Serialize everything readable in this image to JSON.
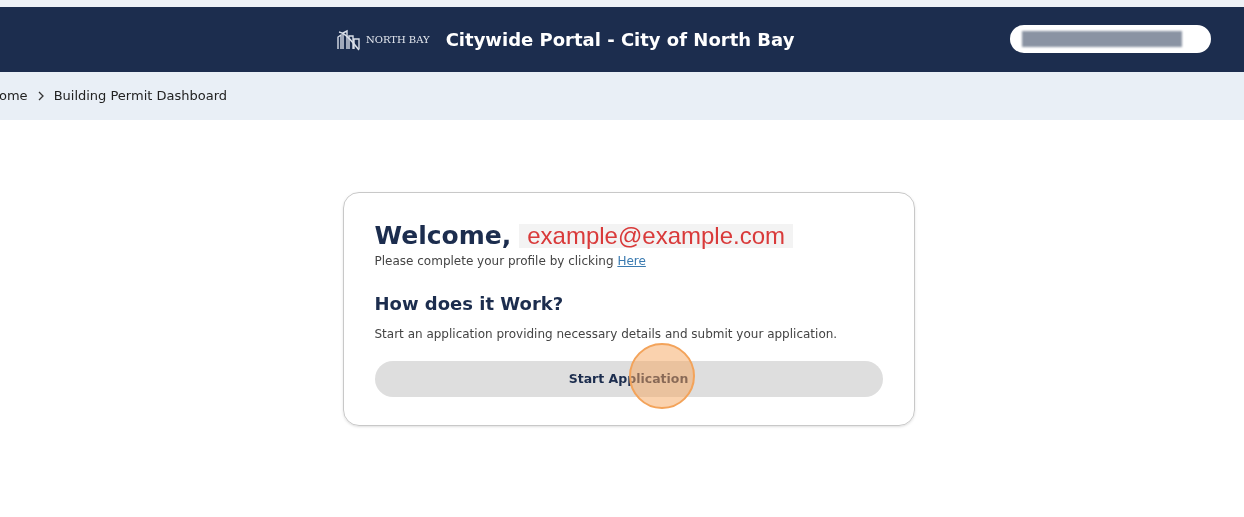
{
  "header": {
    "logo_text": "NORTH BAY",
    "title": "Citywide Portal - City of North Bay"
  },
  "breadcrumb": [
    {
      "label": "ome"
    },
    {
      "label": "Building Permit Dashboard"
    }
  ],
  "card": {
    "greeting": "Welcome,",
    "email": "example@example.com",
    "profile_text": "Please complete your profile by clicking",
    "profile_link": "Here",
    "heading": "How does it Work?",
    "description": "Start an application providing necessary details and submit your application.",
    "button": "Start Application"
  }
}
